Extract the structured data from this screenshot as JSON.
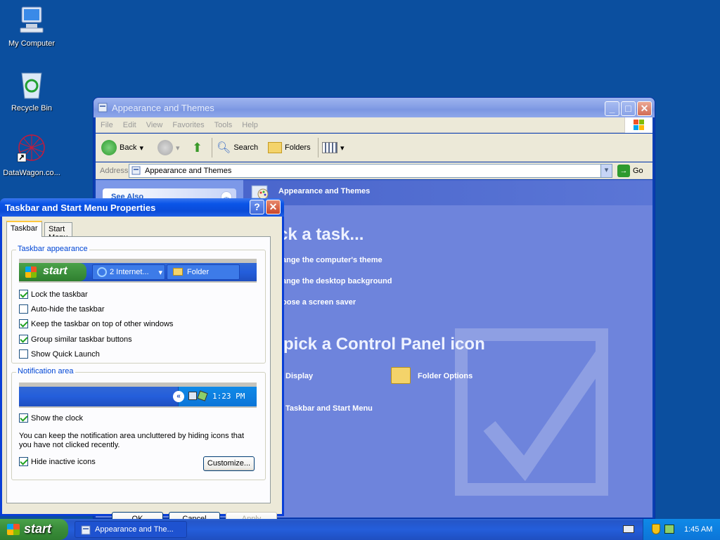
{
  "desktop": {
    "icons": [
      {
        "label": "My Computer",
        "icon": "my-computer-icon"
      },
      {
        "label": "Recycle Bin",
        "icon": "recycle-bin-icon"
      },
      {
        "label": "DataWagon.co...",
        "icon": "shortcut-icon"
      }
    ]
  },
  "explorer": {
    "title": "Appearance and Themes",
    "menu": [
      "File",
      "Edit",
      "View",
      "Favorites",
      "Tools",
      "Help"
    ],
    "toolbar": {
      "back": "Back",
      "search": "Search",
      "folders": "Folders"
    },
    "address": {
      "label": "Address",
      "value": "Appearance and Themes",
      "go": "Go"
    },
    "left_pane": {
      "see_also": "See Also"
    },
    "right_pane": {
      "header": "Appearance and Themes",
      "pick_task": "ck a task...",
      "tasks": [
        "ange the computer's theme",
        "ange the desktop background",
        "oose a screen saver"
      ],
      "pick_icon": "pick a Control Panel icon",
      "icons": [
        "Display",
        "Folder Options",
        "Taskbar and Start Menu"
      ]
    }
  },
  "dialog": {
    "title": "Taskbar and Start Menu Properties",
    "tabs": [
      "Taskbar",
      "Start Menu"
    ],
    "appearance": {
      "title": "Taskbar appearance",
      "preview": {
        "start": "start",
        "item1": "2 Internet...",
        "item2": "Folder"
      },
      "options": [
        {
          "label": "Lock the taskbar",
          "checked": true
        },
        {
          "label": "Auto-hide the taskbar",
          "checked": false
        },
        {
          "label": "Keep the taskbar on top of other windows",
          "checked": true
        },
        {
          "label": "Group similar taskbar buttons",
          "checked": true
        },
        {
          "label": "Show Quick Launch",
          "checked": false
        }
      ]
    },
    "notification": {
      "title": "Notification area",
      "preview_time": "1:23 PM",
      "show_clock": "Show the clock",
      "desc": "You can keep the notification area uncluttered by hiding icons that you have not clicked recently.",
      "hide_inactive": "Hide inactive icons",
      "customize": "Customize..."
    },
    "buttons": {
      "ok": "OK",
      "cancel": "Cancel",
      "apply": "Apply"
    }
  },
  "taskbar": {
    "start": "start",
    "item": "Appearance and The...",
    "clock": "1:45 AM"
  }
}
